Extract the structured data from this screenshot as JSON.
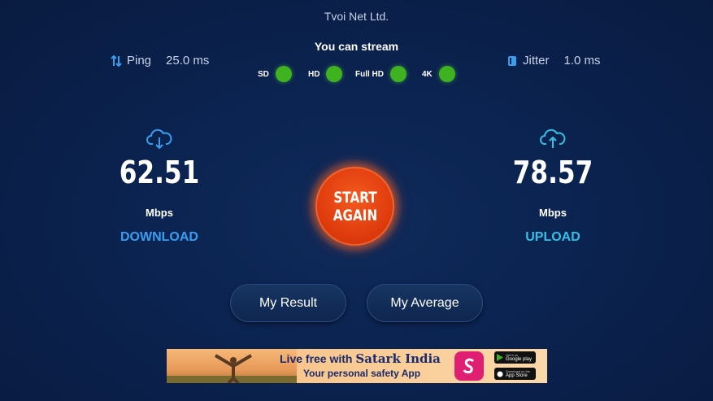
{
  "header": {
    "isp": "Tvoi Net Ltd."
  },
  "ping": {
    "label": "Ping",
    "value": "25.0 ms"
  },
  "jitter": {
    "label": "Jitter",
    "value": "1.0 ms"
  },
  "stream": {
    "title": "You can stream",
    "qualities": [
      {
        "label": "SD",
        "status": "ok"
      },
      {
        "label": "HD",
        "status": "ok"
      },
      {
        "label": "Full HD",
        "status": "ok"
      },
      {
        "label": "4K",
        "status": "ok"
      }
    ]
  },
  "download": {
    "value": "62.51",
    "unit": "Mbps",
    "label": "DOWNLOAD"
  },
  "upload": {
    "value": "78.57",
    "unit": "Mbps",
    "label": "UPLOAD"
  },
  "start_button": {
    "line1": "START",
    "line2": "AGAIN"
  },
  "buttons": {
    "result": "My Result",
    "average": "My Average"
  },
  "ad": {
    "headline": "Live free with",
    "brand": "Satark India",
    "subline": "Your personal safety App",
    "google_play_small": "Get it on",
    "google_play": "Google play",
    "app_store_small": "Download on the",
    "app_store": "App Store"
  },
  "colors": {
    "status_ok": "#3fb21f",
    "start": "#e03c0e",
    "download": "#3a9ef0",
    "upload": "#34c0e6"
  }
}
